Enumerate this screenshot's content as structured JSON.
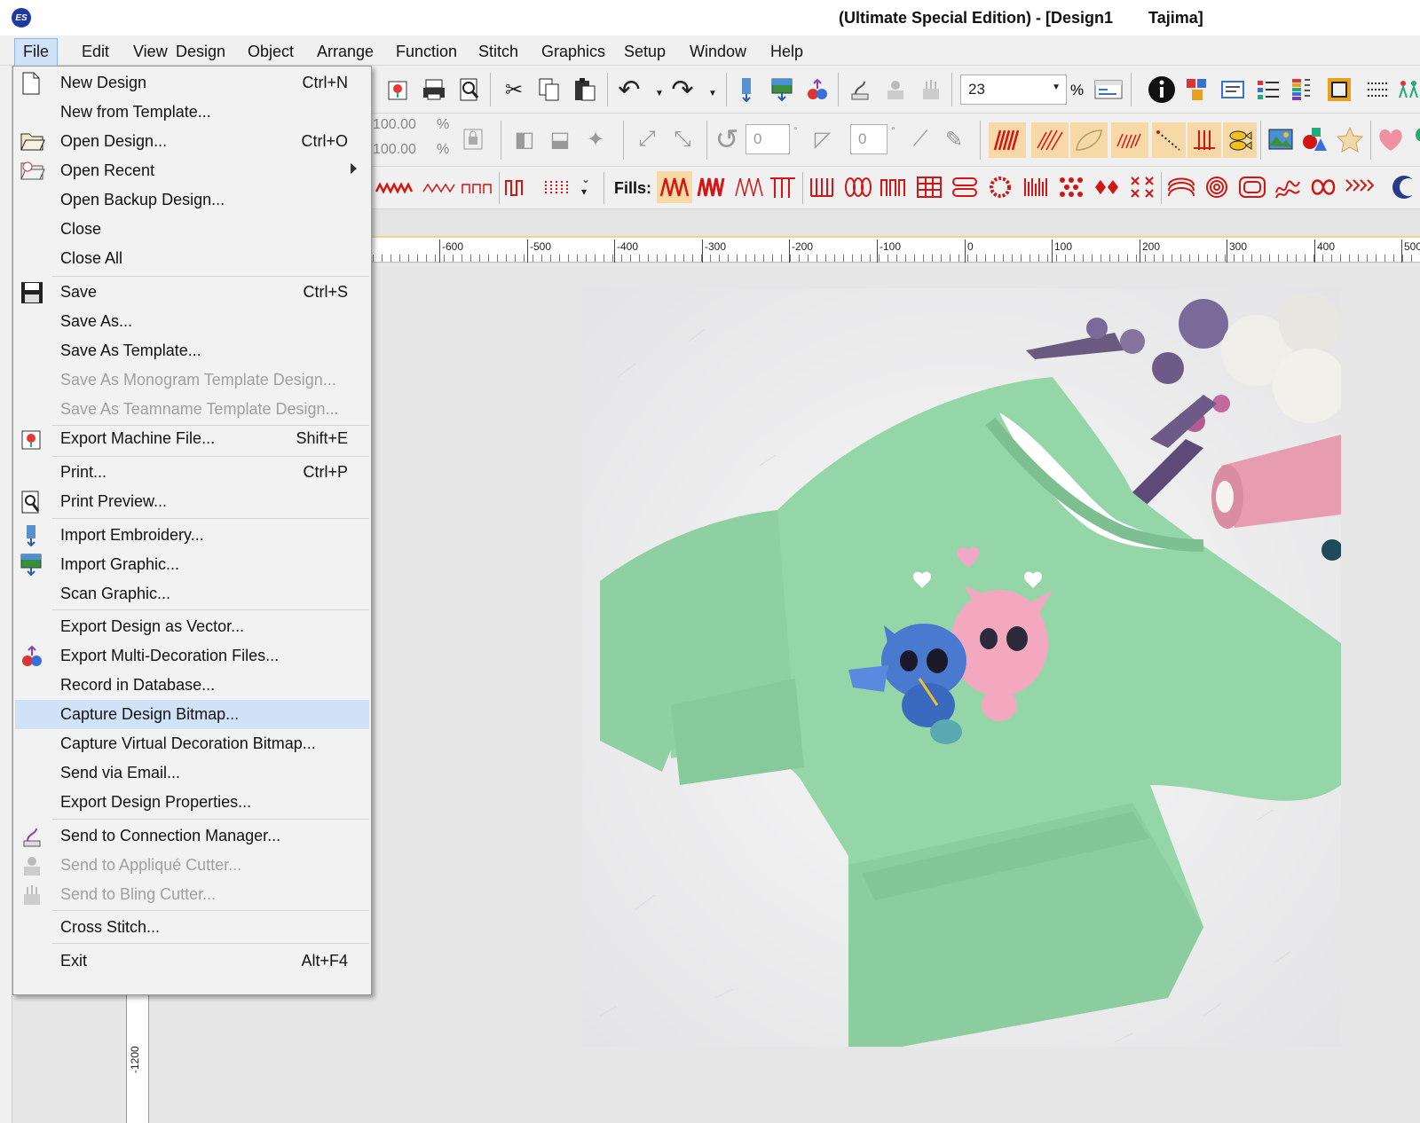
{
  "window": {
    "title": "(Ultimate Special Edition) - [Design1        Tajima]",
    "logo_text": "ES"
  },
  "menubar": {
    "items": [
      "File",
      "Edit",
      "View",
      "Design",
      "Object",
      "Arrange",
      "Function",
      "Stitch",
      "Graphics",
      "Setup",
      "Window",
      "Help"
    ],
    "active": "File"
  },
  "toolbar": {
    "zoom_value": "23",
    "zoom_unit": "%",
    "scale_x": "100.00",
    "scale_y": "100.00",
    "pct": "%",
    "rotate_value": "0",
    "skew_value": "0",
    "degree": "°",
    "fills_label": "Fills:"
  },
  "ruler": {
    "labels": [
      "-600",
      "-500",
      "-400",
      "-300",
      "-200",
      "-100",
      "0",
      "100",
      "200",
      "300",
      "400",
      "500"
    ],
    "vertical_label": "-1200"
  },
  "file_menu": {
    "items": [
      {
        "label": "New Design",
        "shortcut": "Ctrl+N",
        "icon": "new-document-icon"
      },
      {
        "label": "New from Template...",
        "shortcut": ""
      },
      {
        "label": "Open Design...",
        "shortcut": "Ctrl+O",
        "icon": "open-folder-icon"
      },
      {
        "label": "Open Recent",
        "shortcut": "",
        "submenu": true,
        "icon": "open-recent-icon"
      },
      {
        "label": "Open Backup Design...",
        "shortcut": ""
      },
      {
        "label": "Close",
        "shortcut": ""
      },
      {
        "label": "Close All",
        "shortcut": ""
      },
      {
        "label": "Save",
        "shortcut": "Ctrl+S",
        "icon": "floppy-disk-icon"
      },
      {
        "label": "Save As...",
        "shortcut": ""
      },
      {
        "label": "Save As Template...",
        "shortcut": ""
      },
      {
        "label": "Save As Monogram Template Design...",
        "shortcut": "",
        "disabled": true
      },
      {
        "label": "Save As Teamname Template Design...",
        "shortcut": "",
        "disabled": true
      },
      {
        "label": "Export Machine File...",
        "shortcut": "Shift+E",
        "icon": "export-machine-icon"
      },
      {
        "label": "Print...",
        "shortcut": "Ctrl+P"
      },
      {
        "label": "Print Preview...",
        "shortcut": "",
        "icon": "print-preview-icon"
      },
      {
        "label": "Import Embroidery...",
        "shortcut": "",
        "icon": "import-embroidery-icon"
      },
      {
        "label": "Import Graphic...",
        "shortcut": "",
        "icon": "import-graphic-icon"
      },
      {
        "label": "Scan Graphic...",
        "shortcut": ""
      },
      {
        "label": "Export Design as Vector...",
        "shortcut": ""
      },
      {
        "label": "Export Multi-Decoration Files...",
        "shortcut": "",
        "icon": "multi-decoration-icon"
      },
      {
        "label": "Record in Database...",
        "shortcut": ""
      },
      {
        "label": "Capture Design Bitmap...",
        "shortcut": "",
        "selected": true
      },
      {
        "label": "Capture Virtual Decoration Bitmap...",
        "shortcut": ""
      },
      {
        "label": "Send via Email...",
        "shortcut": ""
      },
      {
        "label": "Export Design Properties...",
        "shortcut": ""
      },
      {
        "label": "Send to Connection Manager...",
        "shortcut": "",
        "icon": "connection-manager-icon"
      },
      {
        "label": "Send to Appliqué Cutter...",
        "shortcut": "",
        "disabled": true,
        "icon": "applique-cutter-icon"
      },
      {
        "label": "Send to Bling Cutter...",
        "shortcut": "",
        "disabled": true,
        "icon": "bling-cutter-icon"
      },
      {
        "label": "Cross Stitch...",
        "shortcut": ""
      },
      {
        "label": "Exit",
        "shortcut": "Alt+F4"
      }
    ]
  },
  "colors": {
    "sweatshirt": "#95d6a8",
    "selection": "#cfe2f7",
    "accent_red": "#d21515"
  }
}
